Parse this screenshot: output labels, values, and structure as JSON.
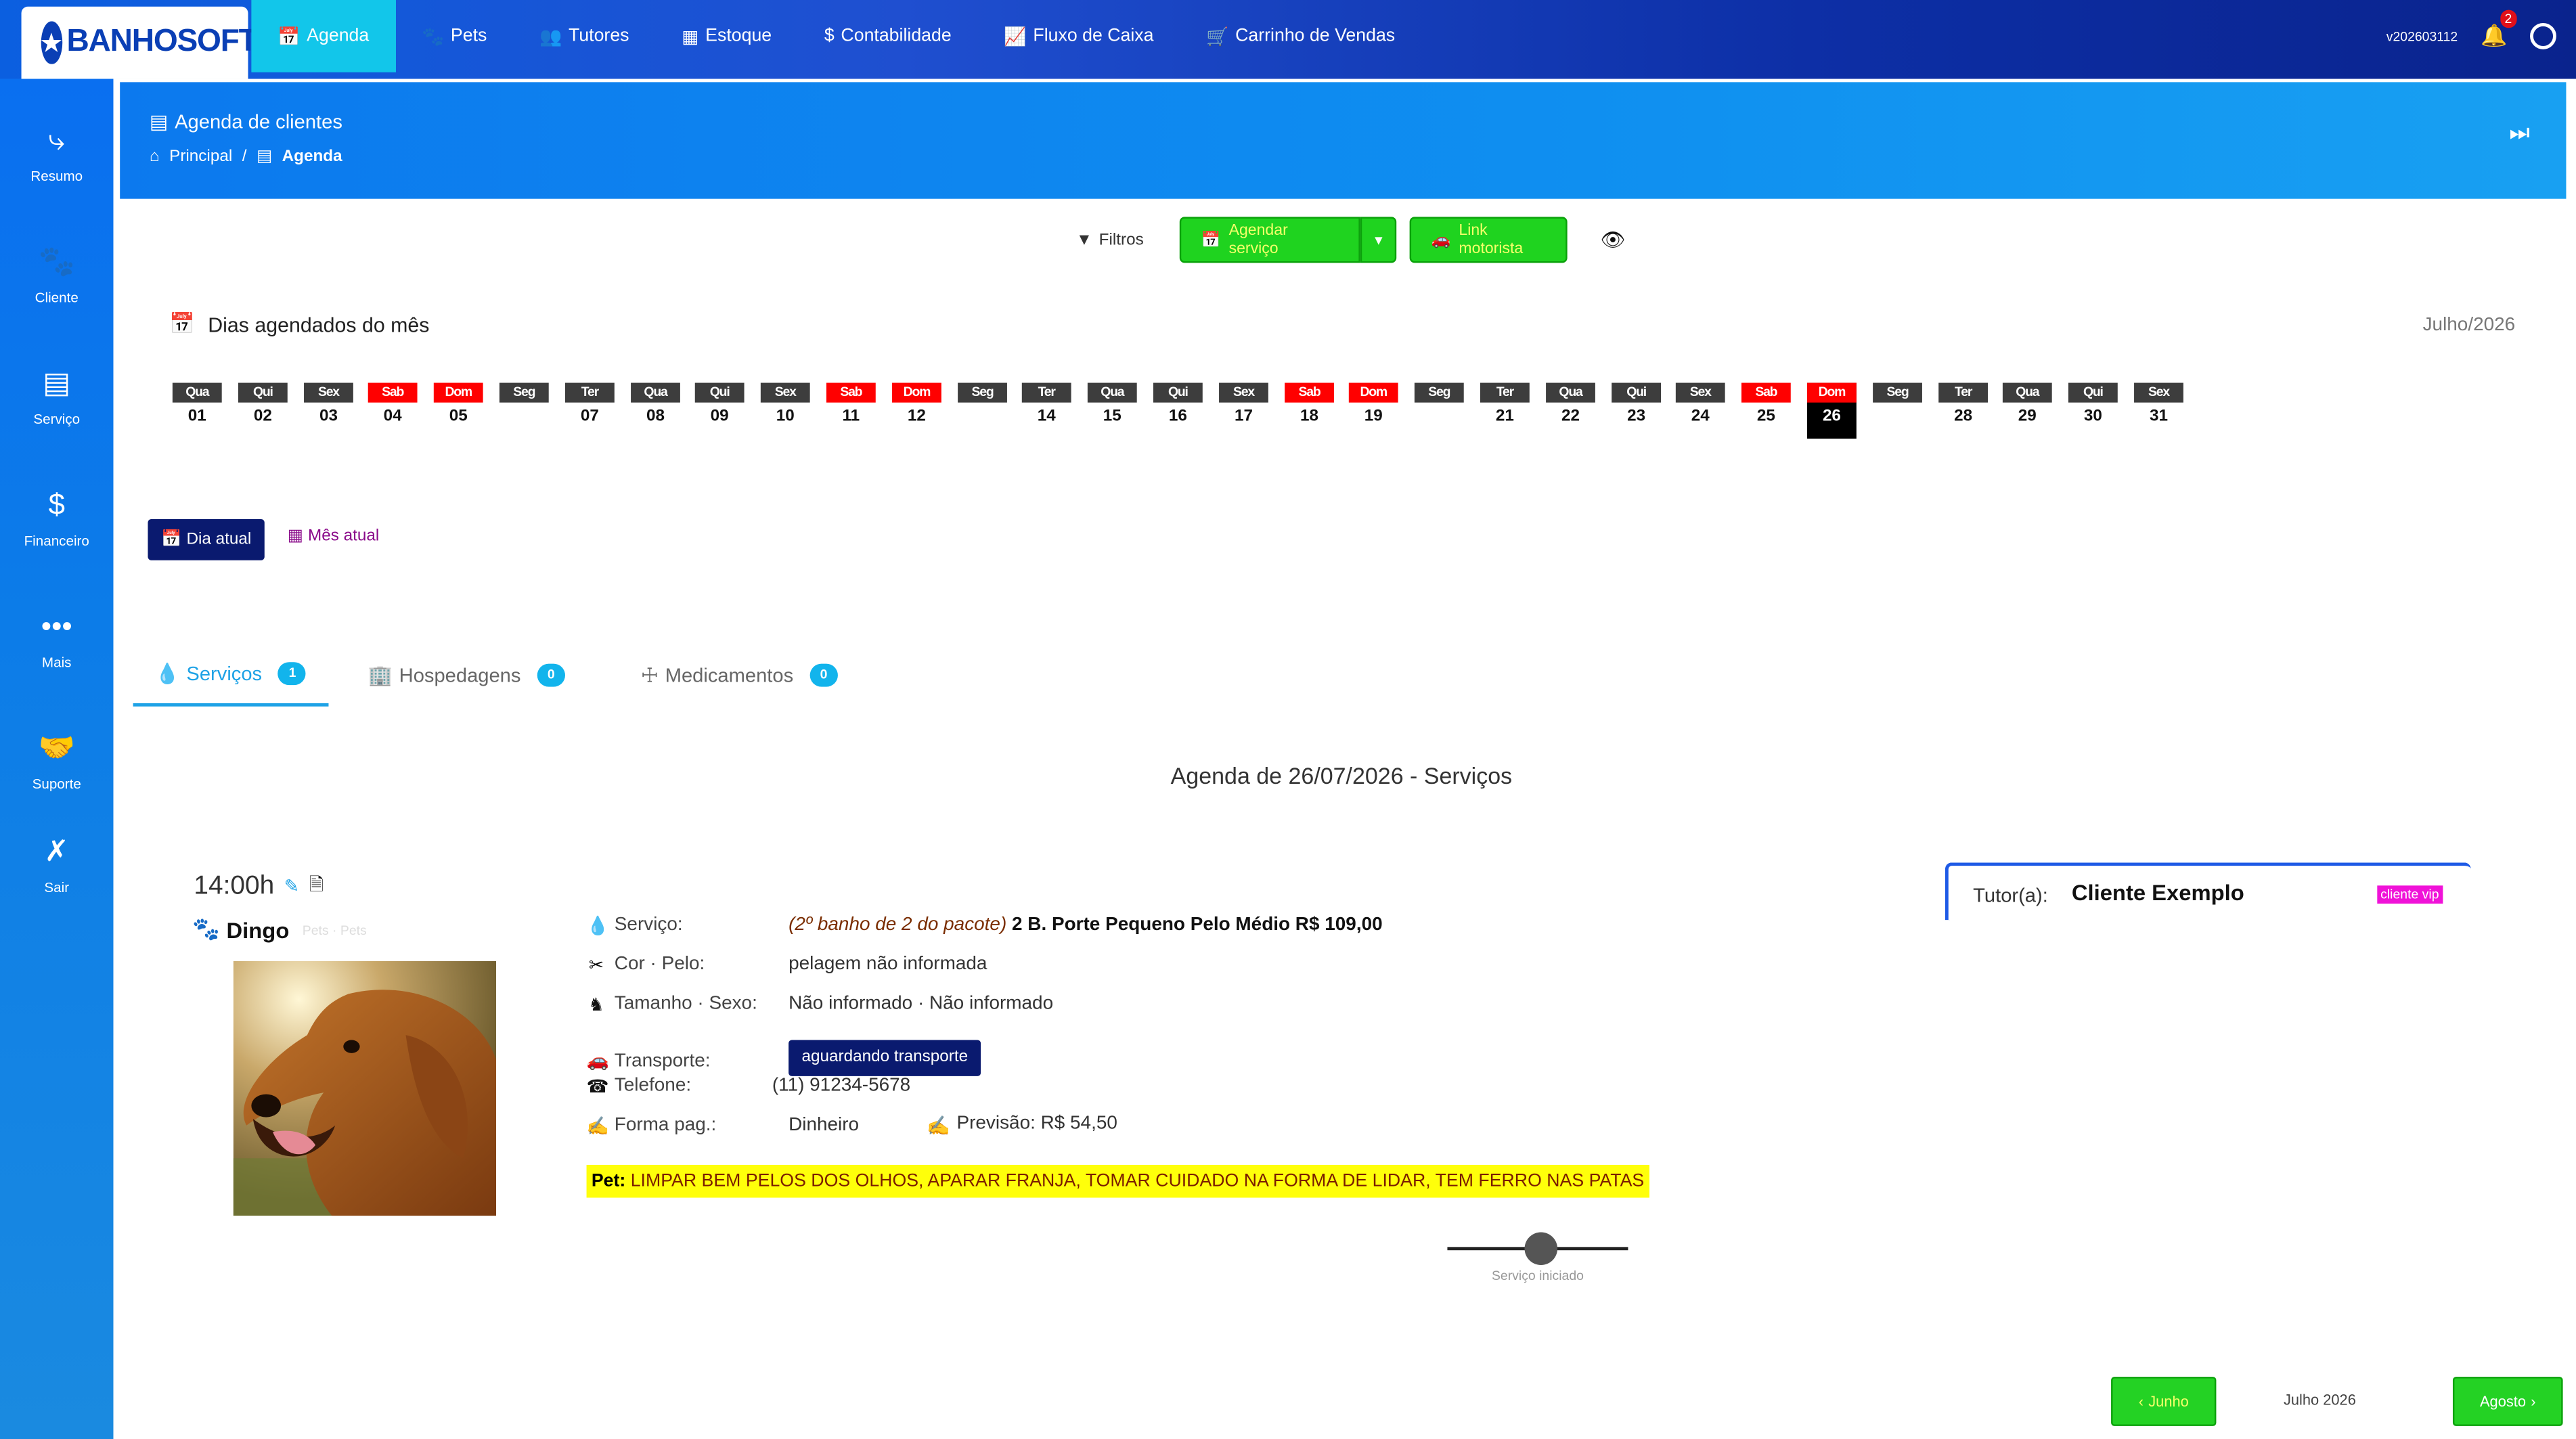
{
  "brand": {
    "name": "BANHOSOFT"
  },
  "nav": {
    "items": [
      {
        "label": "Agenda",
        "icon": "calendar-icon",
        "active": true
      },
      {
        "label": "Pets",
        "icon": "paw-icon"
      },
      {
        "label": "Tutores",
        "icon": "users-icon"
      },
      {
        "label": "Estoque",
        "icon": "dolly-icon"
      },
      {
        "label": "Contabilidade",
        "icon": "dollar-icon"
      },
      {
        "label": "Fluxo de Caixa",
        "icon": "chart-line-icon"
      },
      {
        "label": "Carrinho de Vendas",
        "icon": "cart-icon"
      }
    ],
    "version": "v202603112",
    "notifications": "2"
  },
  "sidebar": {
    "items": [
      {
        "label": "Resumo",
        "icon": "share-icon"
      },
      {
        "label": "Cliente",
        "icon": "paw-icon"
      },
      {
        "label": "Serviço",
        "icon": "book-icon"
      },
      {
        "label": "Financeiro",
        "icon": "dollar-icon"
      },
      {
        "label": "Mais",
        "icon": "dots-icon"
      },
      {
        "label": "Suporte",
        "icon": "handshake-icon"
      },
      {
        "label": "Sair",
        "icon": "user-x-icon"
      }
    ]
  },
  "header": {
    "title": "Agenda de clientes",
    "breadcrumb": {
      "home": "Principal",
      "separator": "/",
      "current": "Agenda"
    }
  },
  "toolbar": {
    "filters": "Filtros",
    "schedule": "Agendar serviço",
    "driver_link": "Link motorista"
  },
  "month": {
    "heading": "Dias agendados do mês",
    "name": "Julho/2026",
    "days": [
      {
        "w": "Qua",
        "d": "01"
      },
      {
        "w": "Qui",
        "d": "02"
      },
      {
        "w": "Sex",
        "d": "03"
      },
      {
        "w": "Sab",
        "d": "04",
        "weekend": true
      },
      {
        "w": "Dom",
        "d": "05",
        "weekend": true
      },
      {
        "w": "Seg",
        "d": ""
      },
      {
        "w": "Ter",
        "d": "07"
      },
      {
        "w": "Qua",
        "d": "08"
      },
      {
        "w": "Qui",
        "d": "09"
      },
      {
        "w": "Sex",
        "d": "10"
      },
      {
        "w": "Sab",
        "d": "11",
        "weekend": true
      },
      {
        "w": "Dom",
        "d": "12",
        "weekend": true
      },
      {
        "w": "Seg",
        "d": ""
      },
      {
        "w": "Ter",
        "d": "14"
      },
      {
        "w": "Qua",
        "d": "15"
      },
      {
        "w": "Qui",
        "d": "16"
      },
      {
        "w": "Sex",
        "d": "17"
      },
      {
        "w": "Sab",
        "d": "18",
        "weekend": true
      },
      {
        "w": "Dom",
        "d": "19",
        "weekend": true
      },
      {
        "w": "Seg",
        "d": ""
      },
      {
        "w": "Ter",
        "d": "21"
      },
      {
        "w": "Qua",
        "d": "22"
      },
      {
        "w": "Qui",
        "d": "23"
      },
      {
        "w": "Sex",
        "d": "24"
      },
      {
        "w": "Sab",
        "d": "25",
        "weekend": true
      },
      {
        "w": "Dom",
        "d": "26",
        "weekend": true,
        "today": true
      },
      {
        "w": "Seg",
        "d": ""
      },
      {
        "w": "Ter",
        "d": "28"
      },
      {
        "w": "Qua",
        "d": "29"
      },
      {
        "w": "Qui",
        "d": "30"
      },
      {
        "w": "Sex",
        "d": "31"
      }
    ]
  },
  "view": {
    "day": "Dia atual",
    "month": "Mês atual"
  },
  "tabs": [
    {
      "label": "Serviços",
      "count": "1",
      "icon": "droplet-icon",
      "active": true
    },
    {
      "label": "Hospedagens",
      "count": "0",
      "icon": "building-icon"
    },
    {
      "label": "Medicamentos",
      "count": "0",
      "icon": "medkit-icon"
    }
  ],
  "agenda": {
    "title": "Agenda de 26/07/2026 - Serviços",
    "entry": {
      "time": "14:00h",
      "pet": "Dingo",
      "pet_faint": "Pets · Pets",
      "service_label": "Serviço:",
      "service_package": "(2º banho de 2 do pacote)",
      "service": "2 B. Porte Pequeno Pelo Médio R$ 109,00",
      "coat_label": "Cor · Pelo:",
      "coat": "pelagem não informada",
      "size_label": "Tamanho · Sexo:",
      "size": "Não informado · Não informado",
      "transport_label": "Transporte:",
      "transport": "aguardando transporte",
      "phone_label": "Telefone:",
      "phone": "(11) 91234-5678",
      "payment_label": "Forma pag.:",
      "payment": "Dinheiro",
      "forecast": "Previsão: R$ 54,50",
      "note_label": "Pet:",
      "note": "LIMPAR BEM PELOS DOS OLHOS, APARAR FRANJA, TOMAR CUIDADO NA FORMA DE LIDAR, TEM FERRO NAS PATAS",
      "status": "Serviço iniciado",
      "tutor_label": "Tutor(a):",
      "tutor": "Cliente Exemplo",
      "tutor_tag": "cliente vip"
    }
  },
  "pager": {
    "prev": "Junho",
    "current": "Julho 2026",
    "next": "Agosto"
  }
}
